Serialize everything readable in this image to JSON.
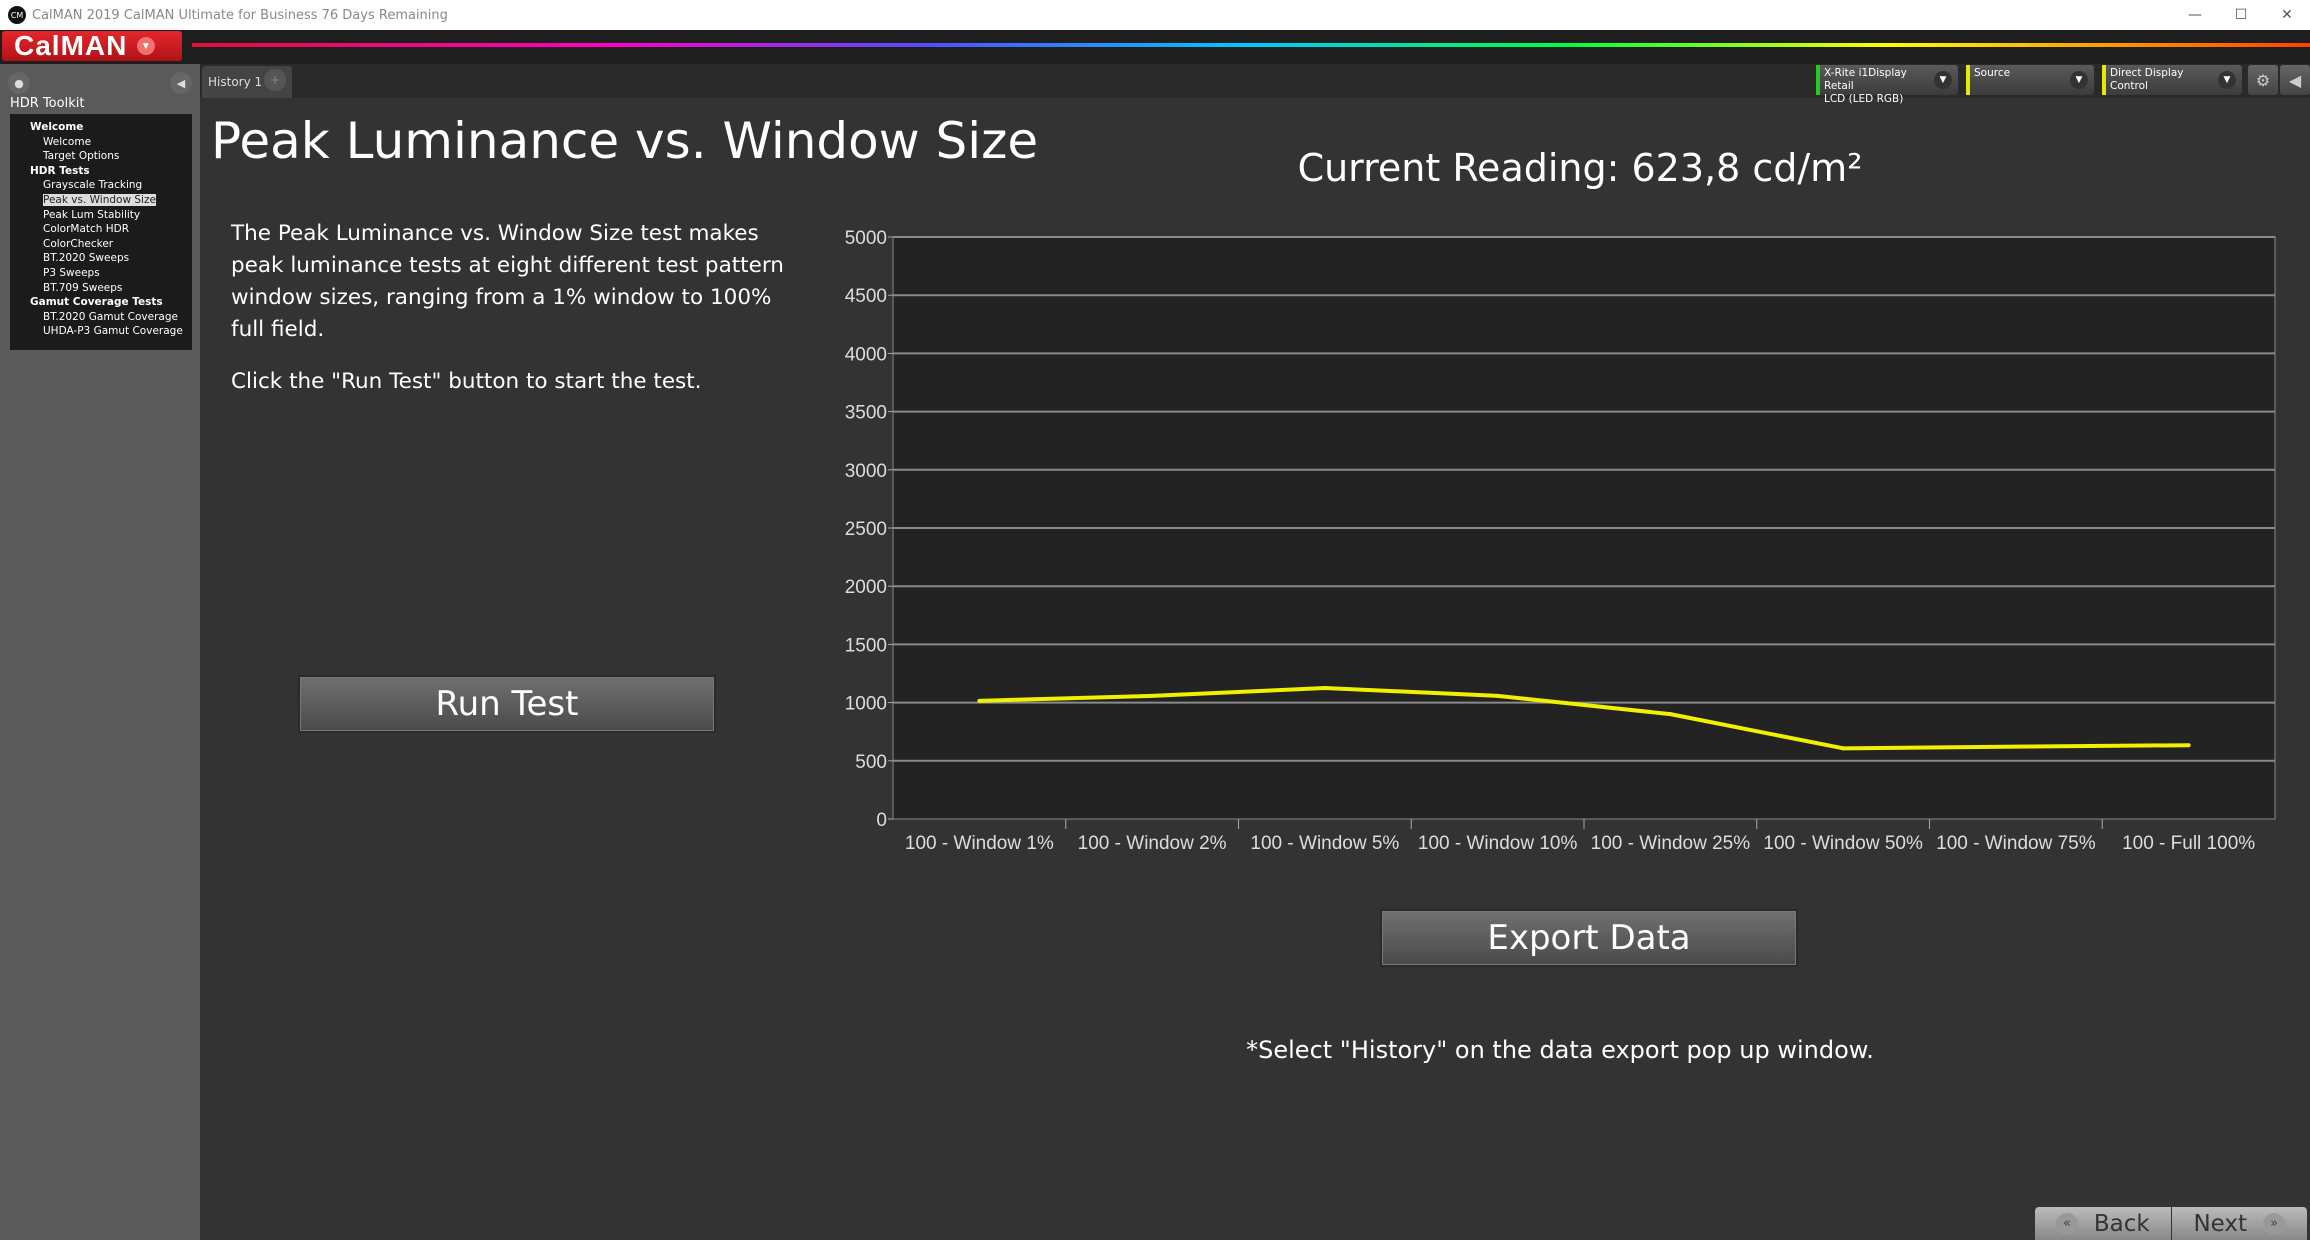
{
  "window": {
    "title": "CalMAN 2019 CalMAN Ultimate for Business 76 Days Remaining",
    "icon": "CM",
    "minimize": "—",
    "maximize": "☐",
    "close": "✕"
  },
  "app": {
    "logo": "CalMAN"
  },
  "sidebar": {
    "title": "HDR Toolkit",
    "tree": [
      {
        "label": "Welcome",
        "type": "group"
      },
      {
        "label": "Welcome",
        "type": "item"
      },
      {
        "label": "Target Options",
        "type": "item"
      },
      {
        "label": "HDR Tests",
        "type": "group"
      },
      {
        "label": "Grayscale Tracking",
        "type": "item"
      },
      {
        "label": "Peak vs. Window Size",
        "type": "item",
        "selected": true
      },
      {
        "label": "Peak Lum Stability",
        "type": "item"
      },
      {
        "label": "ColorMatch HDR",
        "type": "item"
      },
      {
        "label": "ColorChecker",
        "type": "item"
      },
      {
        "label": "BT.2020 Sweeps",
        "type": "item"
      },
      {
        "label": "P3 Sweeps",
        "type": "item"
      },
      {
        "label": "BT.709 Sweeps",
        "type": "item"
      },
      {
        "label": "Gamut Coverage Tests",
        "type": "group"
      },
      {
        "label": "BT.2020 Gamut Coverage",
        "type": "item"
      },
      {
        "label": "UHDA-P3 Gamut Coverage",
        "type": "item"
      }
    ]
  },
  "tabs": [
    {
      "label": "History 1"
    }
  ],
  "devices": [
    {
      "line1": "X-Rite i1Display Retail",
      "line2": "LCD (LED RGB)",
      "color": "#22cc22"
    },
    {
      "line1": "Source",
      "line2": "",
      "color": "#e8e800"
    },
    {
      "line1": "Direct Display Control",
      "line2": "",
      "color": "#e8e800"
    }
  ],
  "main": {
    "title": "Peak Luminance vs. Window Size",
    "description": "The Peak Luminance vs. Window Size test makes peak luminance tests at eight different test pattern window sizes, ranging from a 1% window to 100% full field.",
    "instruction": "Click the \"Run Test\" button to start the test.",
    "run_test": "Run Test",
    "current_reading": "Current Reading: 623,8 cd/m²",
    "export": "Export  Data",
    "note": "*Select \"History\" on the data export pop up window."
  },
  "nav": {
    "back": "Back",
    "next": "Next"
  },
  "chart_data": {
    "type": "line",
    "categories": [
      "100 - Window  1%",
      "100 - Window  2%",
      "100 - Window  5%",
      "100 - Window 10%",
      "100 - Window 25%",
      "100 - Window 50%",
      "100 - Window 75%",
      "100 - Full  100%"
    ],
    "values": [
      1015,
      1058,
      1125,
      1058,
      901,
      607,
      622,
      634
    ],
    "ylim": [
      0,
      5000
    ],
    "yticks": [
      0,
      500,
      1000,
      1500,
      2000,
      2500,
      3000,
      3500,
      4000,
      4500,
      5000
    ],
    "grid": true,
    "line_color": "#f0f000"
  }
}
